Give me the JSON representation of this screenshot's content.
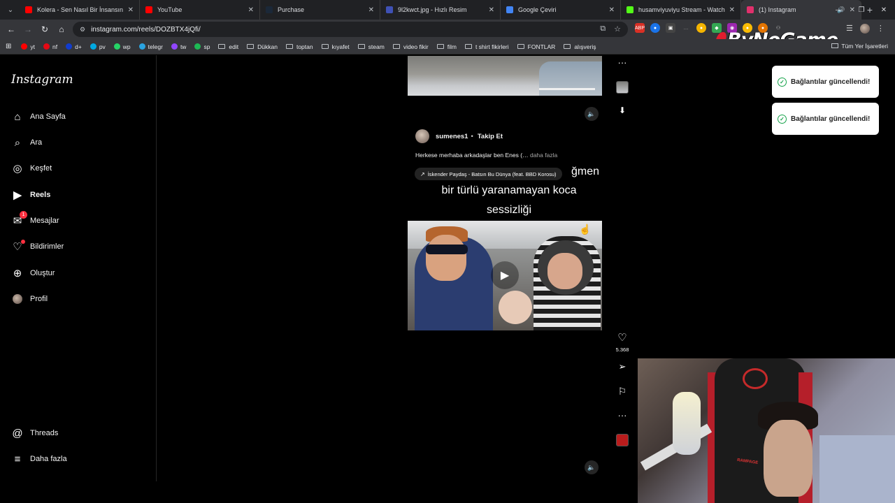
{
  "browser": {
    "tabs": [
      {
        "title": "Kolera - Sen Nasıl Bir İnsansın -",
        "color": "#ff0000"
      },
      {
        "title": "YouTube",
        "color": "#ff0000"
      },
      {
        "title": "Purchase",
        "color": "#1b2838"
      },
      {
        "title": "9l2kwct.jpg - Hızlı Resim",
        "color": "#3f51b5"
      },
      {
        "title": "Google Çeviri",
        "color": "#4285f4"
      },
      {
        "title": "husamviyuviyu Stream - Watch",
        "color": "#53fc18"
      },
      {
        "title": "(1) Instagram",
        "color": "#e1306c"
      }
    ],
    "url": "instagram.com/reels/DOZBTX4jQfi/",
    "bookmarks": [
      {
        "label": "yt",
        "color": "#ff0000",
        "type": "site"
      },
      {
        "label": "nf",
        "color": "#e50914",
        "type": "site"
      },
      {
        "label": "d+",
        "color": "#113ccf",
        "type": "site"
      },
      {
        "label": "pv",
        "color": "#00a8e1",
        "type": "site"
      },
      {
        "label": "wp",
        "color": "#25d366",
        "type": "site"
      },
      {
        "label": "telegr",
        "color": "#2aa3e0",
        "type": "site"
      },
      {
        "label": "tw",
        "color": "#9146ff",
        "type": "site"
      },
      {
        "label": "sp",
        "color": "#1db954",
        "type": "site"
      },
      {
        "label": "edit",
        "type": "folder"
      },
      {
        "label": "Dükkan",
        "type": "folder"
      },
      {
        "label": "toptan",
        "type": "folder"
      },
      {
        "label": "kıyafet",
        "type": "folder"
      },
      {
        "label": "steam",
        "type": "folder"
      },
      {
        "label": "video fikir",
        "type": "folder"
      },
      {
        "label": "film",
        "type": "folder"
      },
      {
        "label": "t shirt fikirleri",
        "type": "folder"
      },
      {
        "label": "FONTLAR",
        "type": "folder"
      },
      {
        "label": "alışveriş",
        "type": "folder"
      }
    ],
    "all_bookmarks": "Tüm Yer İşaretleri",
    "brand_overlay": "ByNoGame"
  },
  "instagram": {
    "logo": "Instagram",
    "nav": [
      {
        "label": "Ana Sayfa",
        "icon": "home-icon"
      },
      {
        "label": "Ara",
        "icon": "search-icon"
      },
      {
        "label": "Keşfet",
        "icon": "compass-icon"
      },
      {
        "label": "Reels",
        "icon": "reels-icon"
      },
      {
        "label": "Mesajlar",
        "icon": "messenger-icon",
        "badge": "1"
      },
      {
        "label": "Bildirimler",
        "icon": "heart-icon"
      },
      {
        "label": "Oluştur",
        "icon": "plus-icon"
      },
      {
        "label": "Profil",
        "icon": "avatar"
      }
    ],
    "bottom_nav": [
      {
        "label": "Threads",
        "icon": "threads-icon"
      },
      {
        "label": "Daha fazla",
        "icon": "menu-icon"
      }
    ]
  },
  "reel": {
    "username": "sumenes1",
    "separator": "•",
    "follow_label": "Takip Et",
    "caption": "Herkese merhaba arkadaşlar ben Enes (",
    "caption_ellipsis": "…",
    "caption_more": "daha fazla",
    "audio": "İskender Paydaş - Batsın Bu Dünya (feat. BBD Korosu)",
    "overlay_line1": "ğmen",
    "overlay_line2": "bir türlü yaranamayan koca",
    "overlay_line3": "sessizliği",
    "likes": "5.368"
  },
  "toasts": [
    {
      "text": "Bağlantılar güncellendi!"
    },
    {
      "text": "Bağlantılar güncellendi!"
    }
  ],
  "webcam": {
    "chair_text": "RAMPAGE"
  }
}
